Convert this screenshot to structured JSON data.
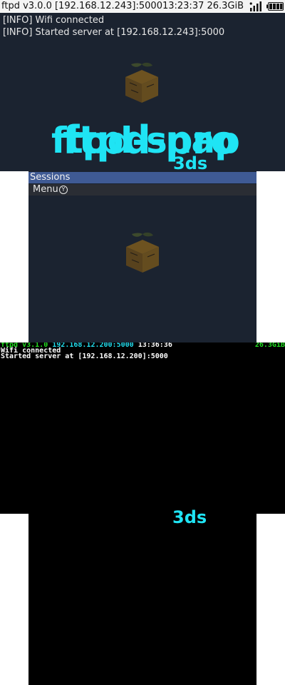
{
  "pro": {
    "status_text": "ftpd v3.0.0 [192.168.12.243]:500013:23:37 26.3GiB",
    "log": [
      "[INFO] Wifi connected",
      "[INFO] Started server at [192.168.12.243]:5000"
    ],
    "logo_title": "ftpd-pro",
    "logo_subtitle": "3ds",
    "sessions_header": "Sessions",
    "menu_label": "Menu",
    "menu_button_glyph": "Y",
    "icons": [
      "wifi-signal-icon",
      "battery-icon",
      "box-watermark-icon",
      "y-button-icon"
    ]
  },
  "snap": {
    "app_version": "ftpd v3.1.0",
    "address": "192.168.12.200:5000",
    "clock": "13:36:36",
    "storage": "26.3GiB",
    "log": [
      "Wifi connected",
      "Started server at [192.168.12.200]:5000"
    ],
    "logo_title": "ftpd-snap",
    "logo_subtitle": "3ds"
  },
  "colors": {
    "logo_cyan": "#1fe4f4",
    "pro_background": "#1b2330",
    "pro_header": "#3f5a94",
    "snap_background": "#000000",
    "snap_green": "#22dd22",
    "snap_cyan": "#22ddee"
  }
}
